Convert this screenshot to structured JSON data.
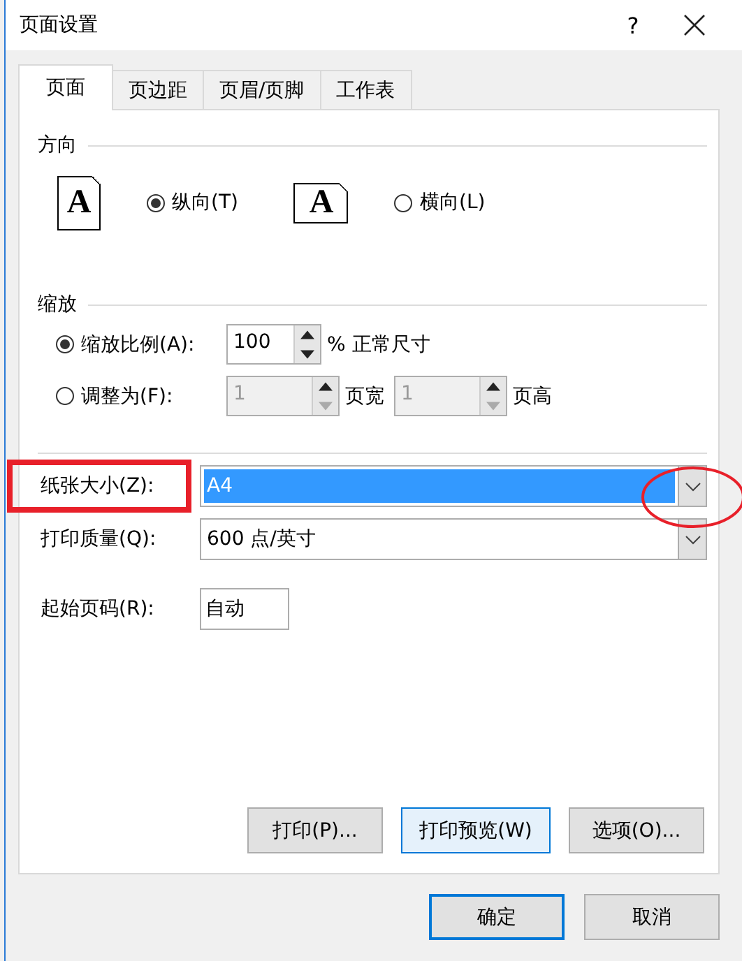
{
  "window": {
    "title": "页面设置",
    "help": "?"
  },
  "tabs": [
    {
      "label": "页面",
      "selected": true
    },
    {
      "label": "页边距",
      "selected": false
    },
    {
      "label": "页眉/页脚",
      "selected": false
    },
    {
      "label": "工作表",
      "selected": false
    }
  ],
  "orientation": {
    "label": "方向",
    "options": [
      {
        "label": "纵向(T)",
        "glyph": "A",
        "kind": "portrait",
        "selected": true
      },
      {
        "label": "横向(L)",
        "glyph": "A",
        "kind": "landscape",
        "selected": false
      }
    ]
  },
  "scaling": {
    "label": "缩放",
    "options": [
      {
        "kind": "percent",
        "label": "缩放比例(A):",
        "selected": true,
        "value": "100",
        "suffix": "% 正常尺寸"
      },
      {
        "kind": "fit",
        "label": "调整为(F):",
        "selected": false,
        "disabled": true,
        "wide_value": "1",
        "wide_label": "页宽",
        "tall_value": "1",
        "tall_label": "页高"
      }
    ]
  },
  "fields": [
    {
      "kind": "dropdown",
      "label": "纸张大小(Z):",
      "value": "A4",
      "selected": true
    },
    {
      "kind": "dropdown",
      "label": "打印质量(Q):",
      "value": "600 点/英寸"
    },
    {
      "kind": "text",
      "label": "起始页码(R):",
      "value": "自动"
    }
  ],
  "buttons": [
    {
      "label": "打印(P)...",
      "focused": false
    },
    {
      "label": "打印预览(W)",
      "focused": true
    },
    {
      "label": "选项(O)...",
      "focused": false
    }
  ],
  "footer_buttons": [
    {
      "label": "确定",
      "default": true
    },
    {
      "label": "取消",
      "default": false
    }
  ]
}
